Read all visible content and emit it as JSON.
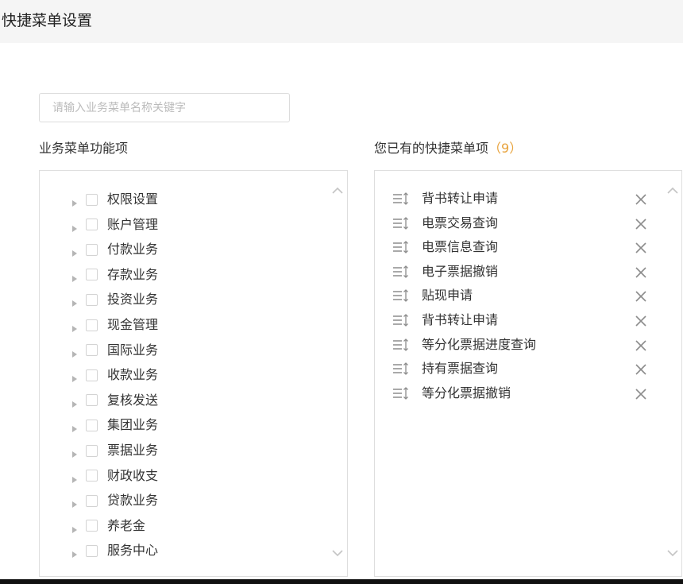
{
  "header": {
    "title": "快捷菜单设置"
  },
  "search": {
    "placeholder": "请输入业务菜单名称关键字",
    "value": ""
  },
  "left_panel": {
    "label": "业务菜单功能项",
    "items": [
      {
        "label": "权限设置"
      },
      {
        "label": "账户管理"
      },
      {
        "label": "付款业务"
      },
      {
        "label": "存款业务"
      },
      {
        "label": "投资业务"
      },
      {
        "label": "现金管理"
      },
      {
        "label": "国际业务"
      },
      {
        "label": "收款业务"
      },
      {
        "label": "复核发送"
      },
      {
        "label": "集团业务"
      },
      {
        "label": "票据业务"
      },
      {
        "label": "财政收支"
      },
      {
        "label": "贷款业务"
      },
      {
        "label": "养老金"
      },
      {
        "label": "服务中心"
      }
    ]
  },
  "right_panel": {
    "label": "您已有的快捷菜单项",
    "count": "（9）",
    "items": [
      {
        "label": "背书转让申请"
      },
      {
        "label": "电票交易查询"
      },
      {
        "label": "电票信息查询"
      },
      {
        "label": "电子票据撤销"
      },
      {
        "label": "贴现申请"
      },
      {
        "label": "背书转让申请"
      },
      {
        "label": "等分化票据进度查询"
      },
      {
        "label": "持有票据查询"
      },
      {
        "label": "等分化票据撤销"
      }
    ]
  },
  "colors": {
    "accent": "#e8a33c",
    "border": "#dedede",
    "header_bg": "#f5f5f5",
    "icon": "#8c8c8c"
  }
}
